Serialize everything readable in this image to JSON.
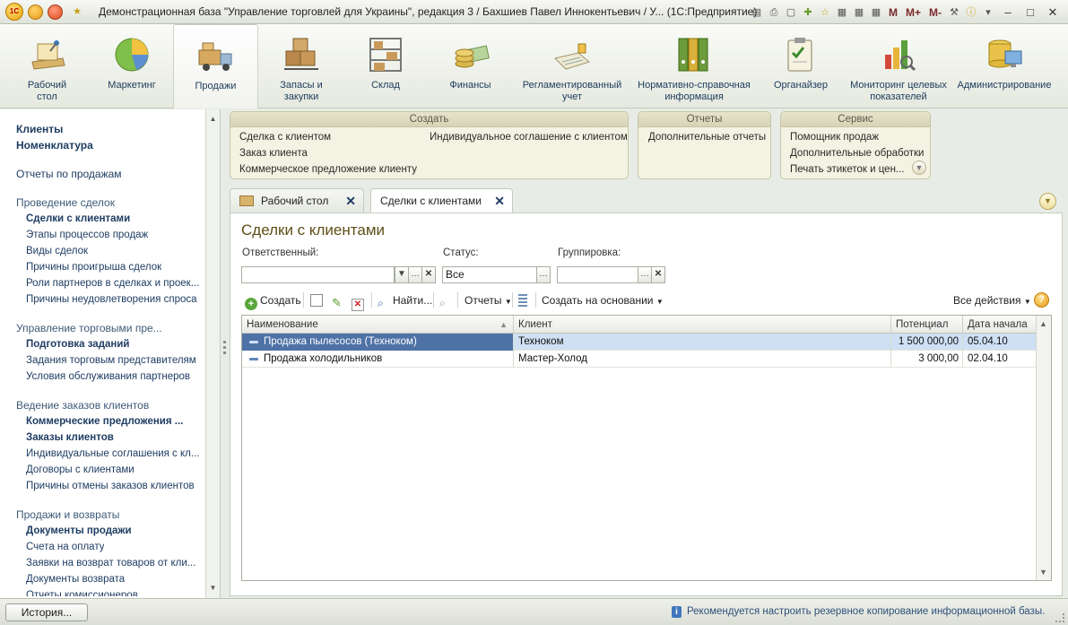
{
  "window": {
    "title": "Демонстрационная база \"Управление торговлей для Украины\", редакция 3 / Бахшиев Павел Иннокентьевич / У...  (1С:Предприятие)",
    "logo_text": "1С",
    "mem_buttons": [
      "M",
      "M+",
      "M-"
    ]
  },
  "sections": [
    {
      "label": "Рабочий\nстол",
      "icon": "desktop-icon"
    },
    {
      "label": "Маркетинг",
      "icon": "pie-chart-icon"
    },
    {
      "label": "Продажи",
      "icon": "truck-icon",
      "active": true
    },
    {
      "label": "Запасы и\nзакупки",
      "icon": "boxes-icon"
    },
    {
      "label": "Склад",
      "icon": "warehouse-icon"
    },
    {
      "label": "Финансы",
      "icon": "coins-icon"
    },
    {
      "label": "Регламентированный\nучет",
      "icon": "ledger-icon"
    },
    {
      "label": "Нормативно-справочная\nинформация",
      "icon": "binders-icon"
    },
    {
      "label": "Органайзер",
      "icon": "clipboard-icon"
    },
    {
      "label": "Мониторинг целевых\nпоказателей",
      "icon": "monitoring-icon"
    },
    {
      "label": "Администрирование",
      "icon": "database-icon"
    }
  ],
  "nav": {
    "top": [
      "Клиенты",
      "Номенклатура"
    ],
    "reports": "Отчеты по продажам",
    "groups": [
      {
        "title": "Проведение сделок",
        "items": [
          {
            "label": "Сделки с клиентами",
            "bold": true
          },
          {
            "label": "Этапы процессов продаж"
          },
          {
            "label": "Виды сделок"
          },
          {
            "label": "Причины проигрыша сделок"
          },
          {
            "label": "Роли партнеров в сделках и проек..."
          },
          {
            "label": "Причины неудовлетворения спроса"
          }
        ]
      },
      {
        "title": "Управление торговыми пре...",
        "items": [
          {
            "label": "Подготовка заданий",
            "bold": true
          },
          {
            "label": "Задания торговым представителям"
          },
          {
            "label": "Условия обслуживания партнеров"
          }
        ]
      },
      {
        "title": "Ведение заказов клиентов",
        "items": [
          {
            "label": "Коммерческие предложения ...",
            "bold": true
          },
          {
            "label": "Заказы клиентов",
            "bold": true
          },
          {
            "label": "Индивидуальные соглашения с кл..."
          },
          {
            "label": "Договоры с клиентами"
          },
          {
            "label": "Причины отмены заказов клиентов"
          }
        ]
      },
      {
        "title": "Продажи и возвраты",
        "items": [
          {
            "label": "Документы продажи",
            "bold": true
          },
          {
            "label": "Счета на оплату"
          },
          {
            "label": "Заявки на возврат товаров от кли..."
          },
          {
            "label": "Документы возврата"
          },
          {
            "label": "Отчеты комиссионеров"
          }
        ]
      }
    ]
  },
  "panels": {
    "create": {
      "title": "Создать",
      "col1": [
        "Сделка с клиентом",
        "Заказ клиента",
        "Коммерческое предложение клиенту"
      ],
      "col2": [
        "Индивидуальное соглашение с клиентом"
      ]
    },
    "reports": {
      "title": "Отчеты",
      "items": [
        "Дополнительные отчеты"
      ]
    },
    "service": {
      "title": "Сервис",
      "items": [
        "Помощник продаж",
        "Дополнительные обработки",
        "Печать этикеток и цен..."
      ]
    }
  },
  "tabs": [
    {
      "label": "Рабочий стол",
      "active": false
    },
    {
      "label": "Сделки с клиентами",
      "active": true
    }
  ],
  "form": {
    "title": "Сделки с клиентами",
    "filters": {
      "responsible": {
        "label": "Ответственный:",
        "value": ""
      },
      "status": {
        "label": "Статус:",
        "value": "Все"
      },
      "grouping": {
        "label": "Группировка:",
        "value": ""
      }
    },
    "toolbar": {
      "create": "Создать",
      "find": "Найти...",
      "reports": "Отчеты",
      "create_based": "Создать на основании",
      "all_actions": "Все действия",
      "help": "?"
    },
    "table": {
      "columns": [
        "Наименование",
        "Клиент",
        "Потенциал",
        "Дата начала"
      ],
      "rows": [
        {
          "name": "Продажа пылесосов (Техноком)",
          "client": "Техноком",
          "potential": "1 500 000,00",
          "date": "05.04.10",
          "selected": true
        },
        {
          "name": "Продажа холодильников",
          "client": "Мастер-Холод",
          "potential": "3 000,00",
          "date": "02.04.10",
          "selected": false
        }
      ]
    }
  },
  "status": {
    "history": "История...",
    "notice": "Рекомендуется настроить резервное копирование информационной базы."
  }
}
